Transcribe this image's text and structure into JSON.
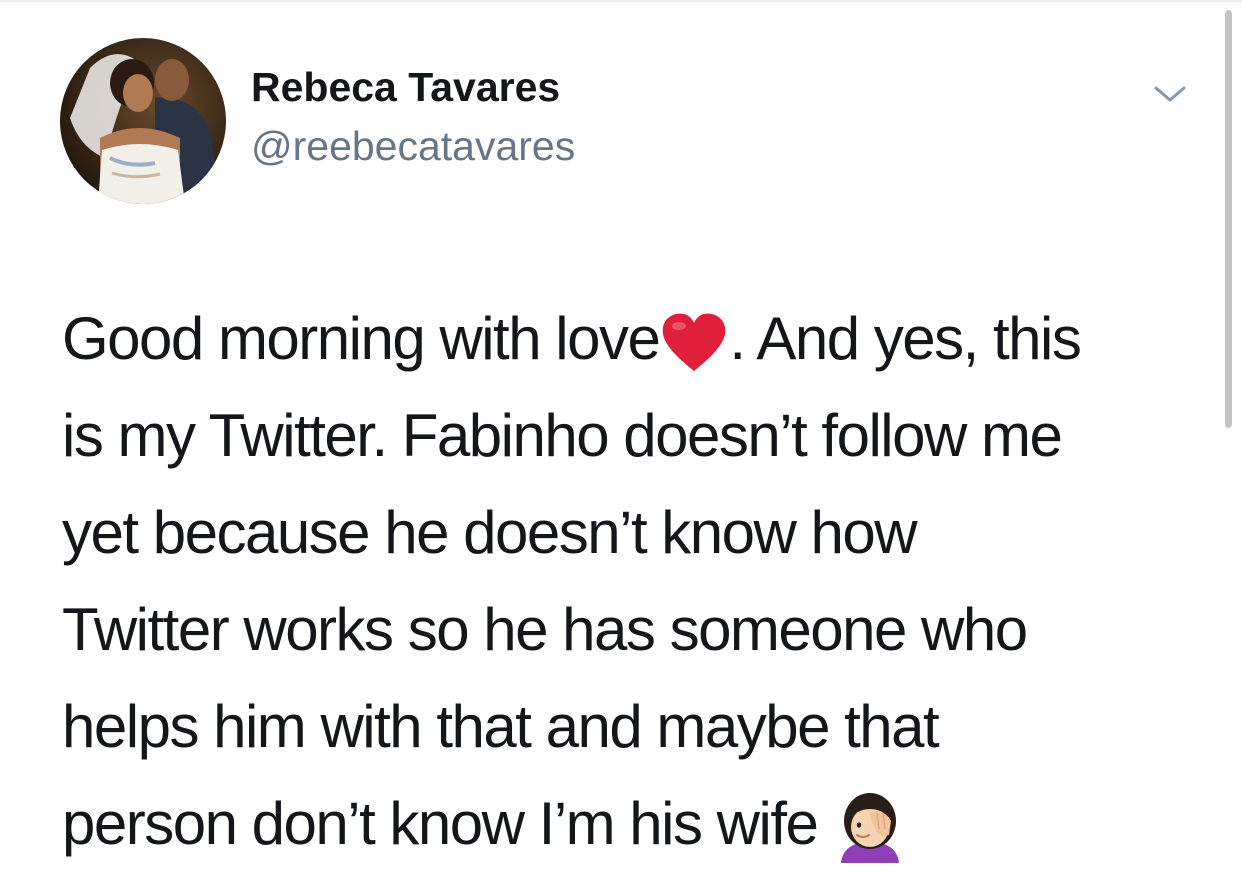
{
  "tweet": {
    "author_name": "Rebeca Tavares",
    "author_handle": "@reebecatavares",
    "lines": [
      {
        "before": "Good morning with love",
        "emoji": "red-heart",
        "after": ". And yes, this"
      },
      {
        "text": "is my Twitter. Fabinho doesn’t follow me"
      },
      {
        "text": "yet because he doesn’t know how"
      },
      {
        "text": "Twitter works so he has someone who"
      },
      {
        "text": "helps him with that and maybe that"
      },
      {
        "before": "person don’t know I’m his wife ",
        "emoji": "woman-facepalming",
        "after": ""
      }
    ]
  },
  "icons": {
    "menu": "chevron-down-icon",
    "heart": "red-heart-emoji",
    "facepalm": "woman-facepalming-emoji"
  },
  "colors": {
    "text": "#14171a",
    "handle": "#657786",
    "chevron": "#8899a6",
    "heart": "#e0203a"
  }
}
